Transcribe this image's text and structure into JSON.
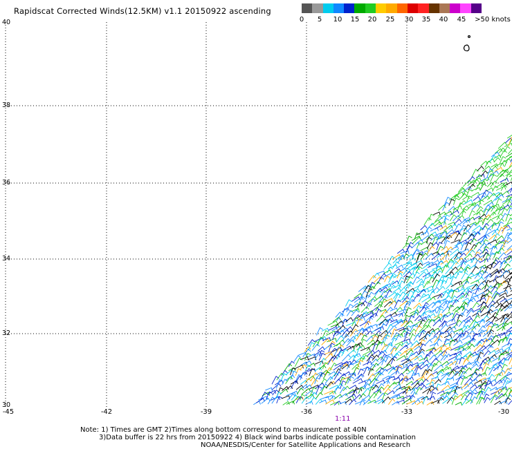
{
  "title": "Rapidscat Corrected Winds(12.5KM) v1.1 20150922 ascending",
  "legend": {
    "labels": [
      "0",
      "5",
      "10",
      "15",
      "20",
      "25",
      "30",
      "35",
      "40",
      "45",
      ">50 knots"
    ],
    "colors": [
      "#555555",
      "#999999",
      "#00ccee",
      "#1188ff",
      "#0022cc",
      "#00aa00",
      "#22cc22",
      "#ffcc00",
      "#ffaa00",
      "#ff6600",
      "#dd0000",
      "#ff2222",
      "#663300",
      "#aa7755",
      "#cc00cc",
      "#ff44ff",
      "#550088"
    ]
  },
  "map": {
    "lat_labels": [
      "40",
      "38",
      "36",
      "34",
      "32",
      "30"
    ],
    "lon_labels": [
      "-45",
      "-42",
      "-39",
      "-36",
      "-33",
      "-30"
    ],
    "time_label": "1:11"
  },
  "notes": {
    "line1": "Note: 1) Times are GMT 2)Times along bottom correspond to measurement at 40N",
    "line2": "3)Data buffer is 22 hrs from 20150922 4) Black wind barbs indicate possible contamination",
    "line3": "NOAA/NESDIS/Center for Satellite Applications and Research"
  }
}
